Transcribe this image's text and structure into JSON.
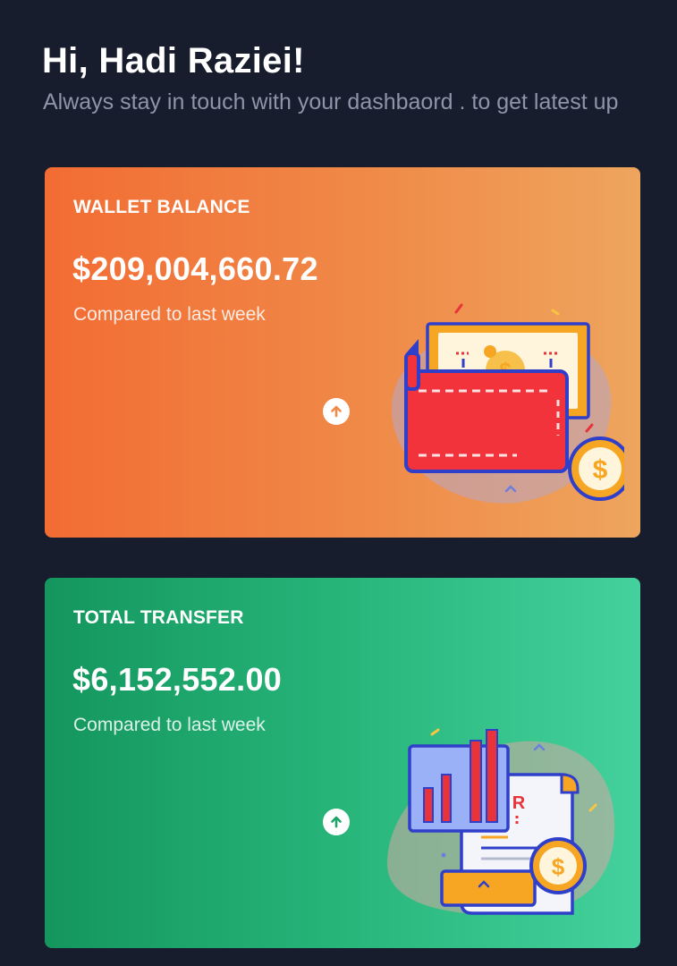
{
  "header": {
    "greeting": "Hi, Hadi Raziei!",
    "subtitle": "Always stay in touch with your dashbaord . to get latest up"
  },
  "cards": [
    {
      "label": "WALLET BALANCE",
      "amount": "$209,004,660.72",
      "compare": "Compared to last week",
      "trend_icon": "arrow-up-circle-icon",
      "illustration": "wallet-illustration"
    },
    {
      "label": "TOTAL TRANSFER",
      "amount": "$6,152,552.00",
      "compare": "Compared to last week",
      "trend_icon": "arrow-up-circle-icon",
      "illustration": "receipt-chart-illustration"
    }
  ],
  "illustration_text": {
    "coin_symbol": "$",
    "receipt_symbol": "R"
  },
  "colors": {
    "background": "#181d2d",
    "wallet_card_start": "#f26c33",
    "wallet_card_end": "#eea55d",
    "transfer_card_start": "#14965e",
    "transfer_card_end": "#44d19d",
    "subtitle": "#8e95a8"
  }
}
